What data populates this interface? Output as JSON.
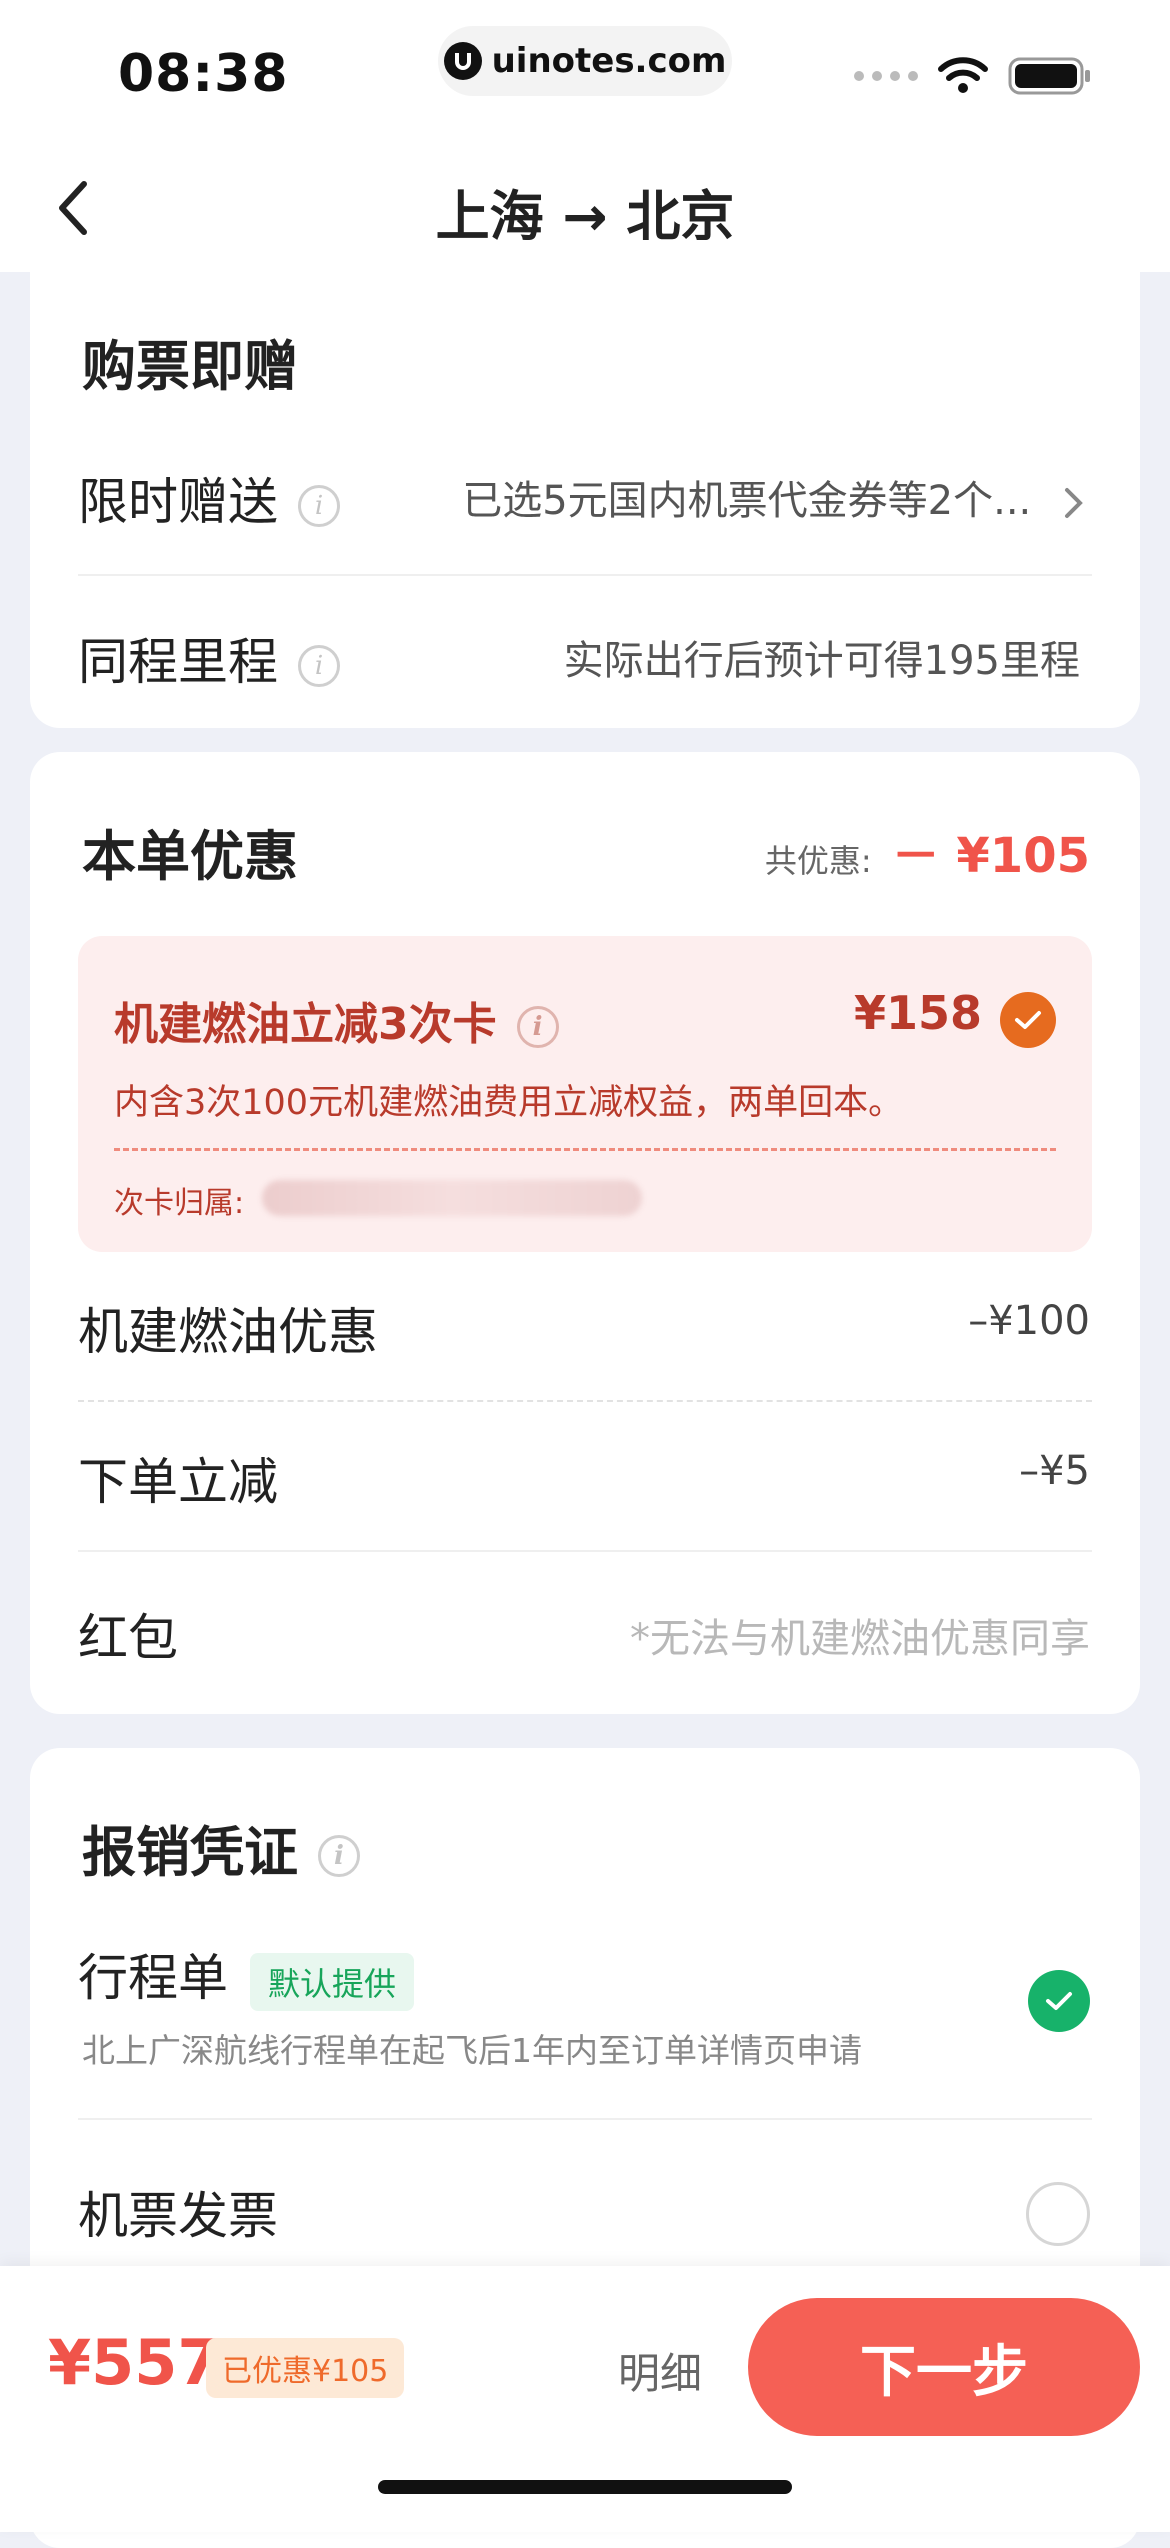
{
  "status_bar": {
    "time": "08:38",
    "url": "uinotes.com"
  },
  "nav": {
    "title": "上海 → 北京"
  },
  "gift_section": {
    "title": "购票即赠",
    "rows": [
      {
        "label": "限时赠送",
        "value": "已选5元国内机票代金券等2个..."
      },
      {
        "label": "同程里程",
        "value": "实际出行后预计可得195里程"
      }
    ]
  },
  "discount_section": {
    "title": "本单优惠",
    "total_label": "共优惠:",
    "total_value": "－ ¥105",
    "promo_card": {
      "title": "机建燃油立减3次卡",
      "price": "¥158",
      "desc": "内含3次100元机建燃油费用立减权益，两单回本。",
      "owner_label": "次卡归属:"
    },
    "rows": [
      {
        "label": "机建燃油优惠",
        "value": "–¥100"
      },
      {
        "label": "下单立减",
        "value": "–¥5"
      },
      {
        "label": "红包",
        "value": "*无法与机建燃油优惠同享"
      }
    ]
  },
  "voucher_section": {
    "title": "报销凭证",
    "itinerary": {
      "label": "行程单",
      "badge": "默认提供",
      "desc": "北上广深航线行程单在起飞后1年内至订单详情页申请",
      "selected": true
    },
    "invoice": {
      "label": "机票发票",
      "selected": false
    }
  },
  "bottom_bar": {
    "total": "¥557",
    "saved": "已优惠¥105",
    "detail": "明细",
    "next": "下一步"
  },
  "colors": {
    "accent": "#f56055",
    "promo_text": "#b83a2b",
    "check_orange": "#e66b1f",
    "check_green": "#17b26a"
  }
}
